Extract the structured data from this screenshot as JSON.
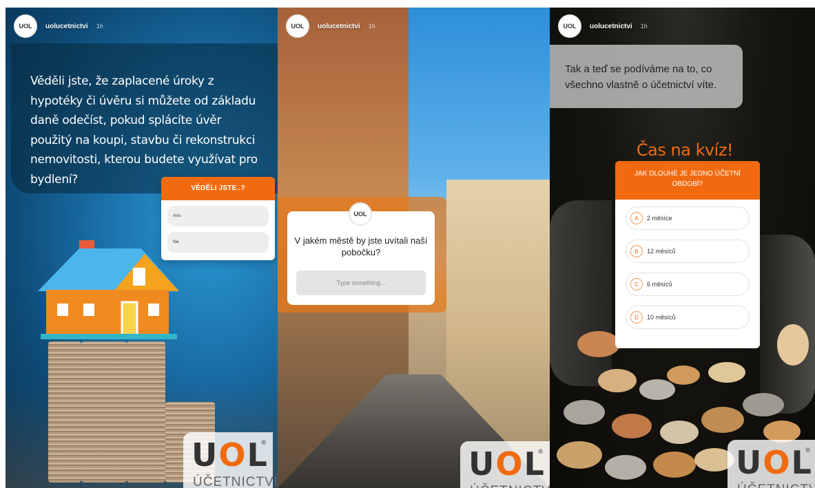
{
  "stories": [
    {
      "username": "uolucetnictvi",
      "time": "1h",
      "avatar_text": "UOL",
      "text": "Věděli jste, že zaplacené úroky z hypotéky či úvěru si můžete od základu daně odečíst, pokud splácíte úvěr použitý na koupi, stavbu či rekonstrukci nemovitosti, kterou budete využívat pro bydlení?",
      "poll": {
        "title": "VĚDĚLI JSTE..?",
        "options": [
          "Ano",
          "Ne"
        ]
      }
    },
    {
      "username": "uolucetnictvi",
      "time": "1h",
      "avatar_text": "UOL",
      "question": "V jakém městě by jste uvítali naší pobočku?",
      "input_placeholder": "Type something..."
    },
    {
      "username": "uolucetnictvi",
      "time": "1h",
      "avatar_text": "UOL",
      "text": "Tak a teď se podíváme na to, co všechno vlastně o účetnictví víte.",
      "quiz_heading": "Čas na kvíz!",
      "quiz": {
        "question": "JAK DLOUHÉ JE JEDNO ÚČETNÍ OBDOBÍ?",
        "options": [
          {
            "letter": "A",
            "label": "2 měsíce"
          },
          {
            "letter": "B",
            "label": "12 měsíců"
          },
          {
            "letter": "C",
            "label": "6 měsíců"
          },
          {
            "letter": "D",
            "label": "10 měsíců"
          }
        ]
      }
    }
  ],
  "logo": {
    "word": "UOL",
    "registered": "®",
    "sub": "ÚČETNICTVÍ"
  },
  "colors": {
    "accent": "#f26a10"
  }
}
